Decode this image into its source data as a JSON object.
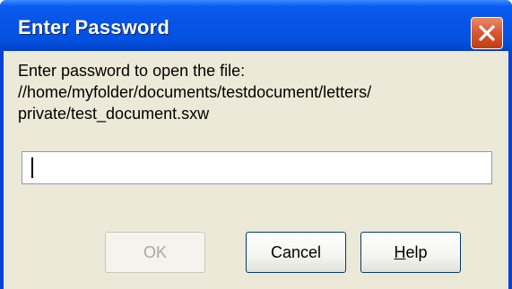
{
  "dialog": {
    "title": "Enter Password",
    "message_lines": [
      "Enter password to open the file:",
      "//home/myfolder/documents/testdocument/letters/",
      "private/test_document.sxw"
    ],
    "password": {
      "value": "",
      "placeholder": ""
    },
    "buttons": {
      "ok": "OK",
      "cancel": "Cancel",
      "help_mnemonic": "H",
      "help_rest": "elp"
    },
    "icons": {
      "close": "close-icon"
    },
    "colors": {
      "titlebar": "#0554e6",
      "close_button": "#d95a32",
      "body": "#ece9d8",
      "input_border": "#7f9db9",
      "button_border": "#003c74"
    }
  }
}
